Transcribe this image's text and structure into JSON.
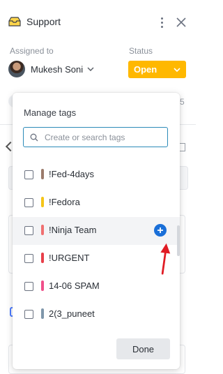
{
  "header": {
    "title": "Support",
    "icon": "inbox-icon"
  },
  "assigned": {
    "label": "Assigned to",
    "name": "Mukesh Soni"
  },
  "status": {
    "label": "Status",
    "value": "Open",
    "color": "#ffb800"
  },
  "background": {
    "count_fragment": "5"
  },
  "tags_popup": {
    "title": "Manage tags",
    "search": {
      "placeholder": "Create or search tags",
      "value": ""
    },
    "tags": [
      {
        "name": "!Fed-4days",
        "color": "#9b7b6b",
        "checked": false
      },
      {
        "name": "!Fedora",
        "color": "#f5c518",
        "checked": false
      },
      {
        "name": "!Ninja Team",
        "color": "#f07070",
        "checked": false
      },
      {
        "name": "!URGENT",
        "color": "#e8404a",
        "checked": false
      },
      {
        "name": "14-06 SPAM",
        "color": "#f0508a",
        "checked": false
      },
      {
        "name": "2(3_puneet",
        "color": "#7f97ab",
        "checked": false
      }
    ],
    "done_label": "Done",
    "accent": "#1a6fd8",
    "annotation_arrow_color": "#e01b24"
  }
}
